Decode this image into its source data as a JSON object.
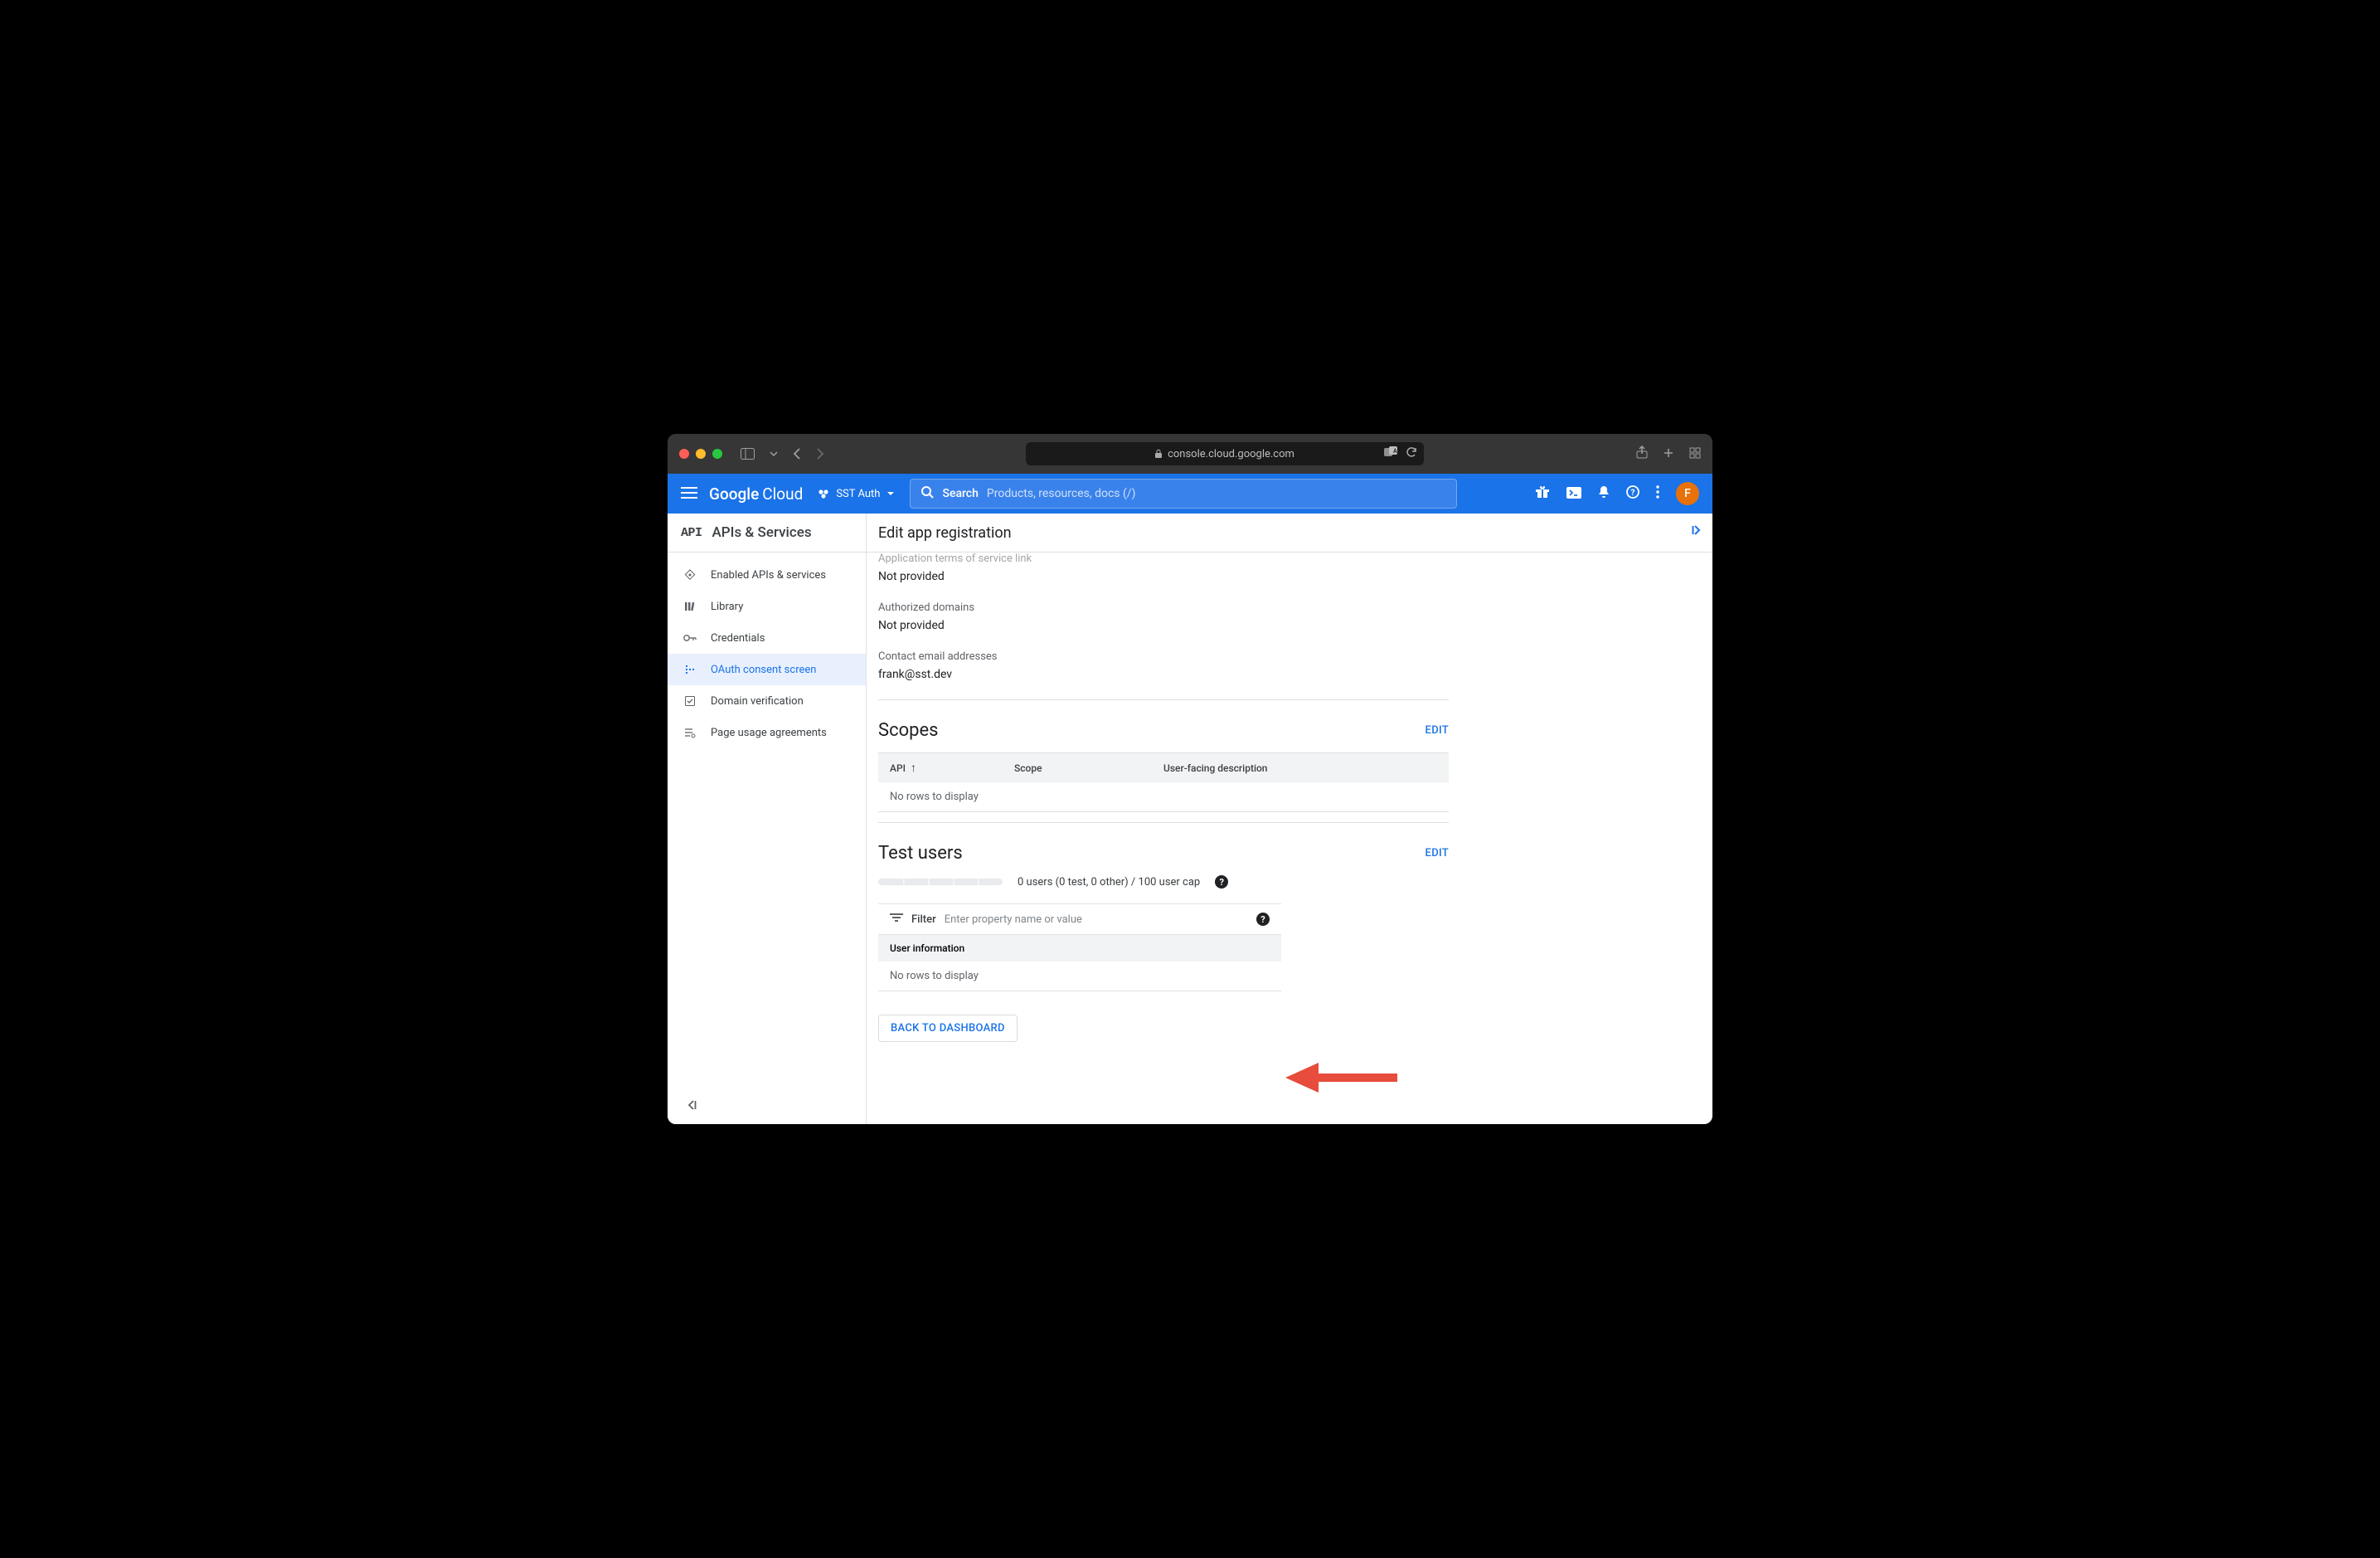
{
  "browser": {
    "url": "console.cloud.google.com"
  },
  "header": {
    "logo_a": "Google",
    "logo_b": "Cloud",
    "project": "SST Auth",
    "search_label": "Search",
    "search_placeholder": "Products, resources, docs (/)",
    "avatar_initial": "F"
  },
  "sidebar": {
    "title": "APIs & Services",
    "items": [
      {
        "label": "Enabled APIs & services"
      },
      {
        "label": "Library"
      },
      {
        "label": "Credentials"
      },
      {
        "label": "OAuth consent screen"
      },
      {
        "label": "Domain verification"
      },
      {
        "label": "Page usage agreements"
      }
    ]
  },
  "main": {
    "title": "Edit app registration",
    "fields": {
      "tos_label": "Application terms of service link",
      "tos_value": "Not provided",
      "auth_domains_label": "Authorized domains",
      "auth_domains_value": "Not provided",
      "contact_label": "Contact email addresses",
      "contact_value": "frank@sst.dev"
    },
    "scopes": {
      "title": "Scopes",
      "edit": "EDIT",
      "columns": {
        "api": "API",
        "scope": "Scope",
        "desc": "User-facing description"
      },
      "empty": "No rows to display"
    },
    "test_users": {
      "title": "Test users",
      "edit": "EDIT",
      "progress_text": "0 users (0 test, 0 other) / 100 user cap",
      "filter_label": "Filter",
      "filter_placeholder": "Enter property name or value",
      "col": "User information",
      "empty": "No rows to display"
    },
    "back_button": "BACK TO DASHBOARD"
  }
}
